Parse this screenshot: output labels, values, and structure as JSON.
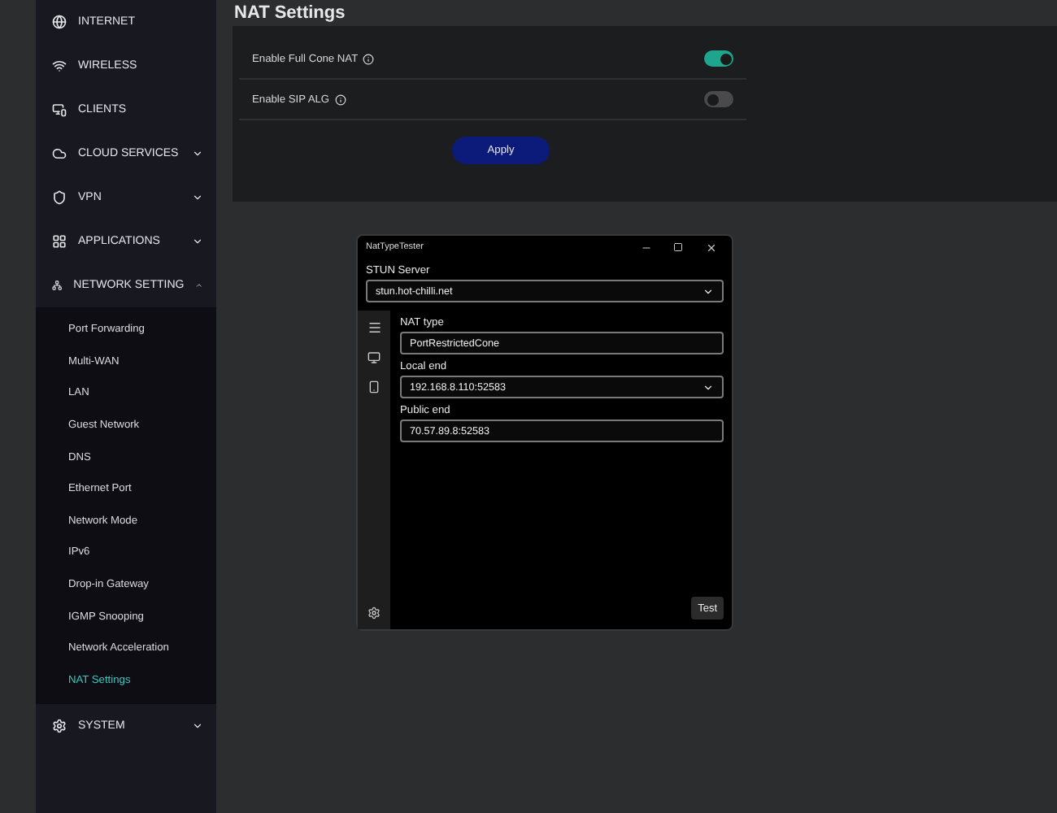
{
  "sidebar": {
    "items": [
      {
        "label": "INTERNET"
      },
      {
        "label": "WIRELESS"
      },
      {
        "label": "CLIENTS"
      },
      {
        "label": "CLOUD SERVICES",
        "expanded": false
      },
      {
        "label": "VPN",
        "expanded": false
      },
      {
        "label": "APPLICATIONS",
        "expanded": false
      },
      {
        "label": "NETWORK SETTING",
        "expanded": true,
        "children": [
          {
            "label": "Port Forwarding",
            "selected": false
          },
          {
            "label": "Multi-WAN",
            "selected": false
          },
          {
            "label": "LAN",
            "selected": false
          },
          {
            "label": "Guest Network",
            "selected": false
          },
          {
            "label": "DNS",
            "selected": false
          },
          {
            "label": "Ethernet Port",
            "selected": false
          },
          {
            "label": "Network Mode",
            "selected": false
          },
          {
            "label": "IPv6",
            "selected": false
          },
          {
            "label": "Drop-in Gateway",
            "selected": false
          },
          {
            "label": "IGMP Snooping",
            "selected": false
          },
          {
            "label": "Network Acceleration",
            "selected": false
          },
          {
            "label": "NAT Settings",
            "selected": true
          }
        ]
      },
      {
        "label": "SYSTEM",
        "expanded": false
      }
    ]
  },
  "page": {
    "title": "NAT Settings",
    "settings": [
      {
        "label": "Enable Full Cone NAT",
        "on": true
      },
      {
        "label": "Enable SIP ALG",
        "on": false
      }
    ],
    "apply_button": "Apply"
  },
  "tester_window": {
    "title": "NatTypeTester",
    "stun_server": {
      "label": "STUN Server",
      "value": "stun.hot-chilli.net"
    },
    "fields": [
      {
        "label": "NAT type",
        "value": "PortRestrictedCone",
        "kind": "text"
      },
      {
        "label": "Local end",
        "value": "192.168.8.110:52583",
        "kind": "combo"
      },
      {
        "label": "Public end",
        "value": "70.57.89.8:52583",
        "kind": "text"
      }
    ],
    "test_button": "Test"
  }
}
